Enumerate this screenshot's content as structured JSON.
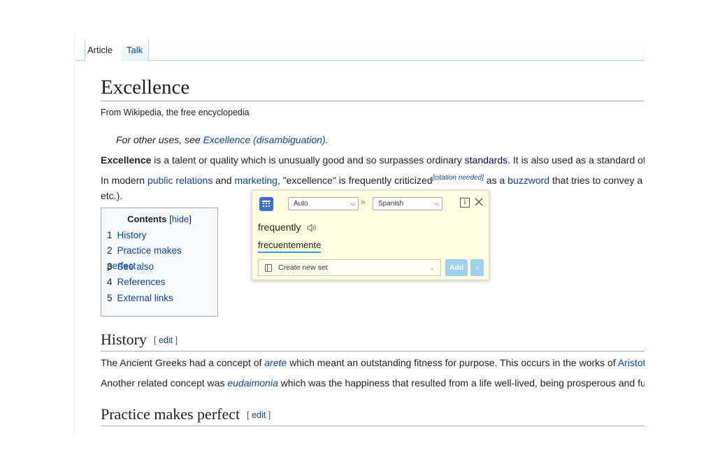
{
  "tabs": {
    "article": "Article",
    "talk": "Talk"
  },
  "article": {
    "title": "Excellence",
    "tagline": "From Wikipedia, the free encyclopedia",
    "hatnote": {
      "prefix": "For other uses, see ",
      "link": "Excellence (disambiguation)",
      "suffix": "."
    },
    "intro1": {
      "bold": "Excellence",
      "text1": " is a talent or quality which is unusually good and so surpasses ordinary ",
      "link1": "standards",
      "text2": ". It is also used as a standard of"
    },
    "intro2": {
      "text1": "In modern ",
      "link1": "public relations",
      "text2": " and ",
      "link2": "marketing",
      "text3": ", \"excellence\" is frequently criticized",
      "sup": "[citation needed]",
      "text4": " as a ",
      "link3": "buzzword",
      "text5": " that tries to convey a"
    },
    "intro3": "etc.)."
  },
  "toc": {
    "title": "Contents",
    "hide_open": "[",
    "hide": "hide",
    "hide_close": "]",
    "items": [
      {
        "num": "1",
        "label": "History"
      },
      {
        "num": "2",
        "label": "Practice makes perfect"
      },
      {
        "num": "3",
        "label": "See also"
      },
      {
        "num": "4",
        "label": "References"
      },
      {
        "num": "5",
        "label": "External links"
      }
    ]
  },
  "sections": {
    "history": {
      "heading": "History",
      "edit_open": "[ ",
      "edit": "edit",
      "edit_close": " ]",
      "p1": {
        "text1": "The Ancient Greeks had a concept of ",
        "link1": "arete",
        "text2": " which meant an outstanding fitness for purpose. This occurs in the works of ",
        "link2": "Aristot"
      },
      "p2": {
        "text1": "Another related concept was ",
        "link1": "eudaimonia",
        "text2": " which was the happiness that resulted from a life well-lived, being prosperous and fu"
      }
    },
    "practice": {
      "heading": "Practice makes perfect",
      "edit_open": "[ ",
      "edit": "edit",
      "edit_close": " ]"
    }
  },
  "popup": {
    "source_lang": "Auto",
    "target_lang": "Spanish",
    "source_word": "frequently",
    "translation": "frecuentemente",
    "set_placeholder": "Create new set",
    "add_label": "Add",
    "colors": {
      "accent": "#2aa3d8",
      "background": "#ffffe1",
      "logo": "#3a6ee0"
    }
  }
}
